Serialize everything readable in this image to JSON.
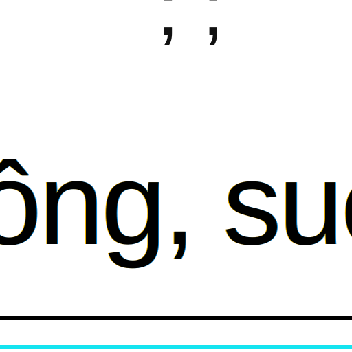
{
  "document": {
    "top_fragment": "; ;",
    "main_text": "ông, suc"
  },
  "colors": {
    "background": "#ffffff",
    "text": "#000000",
    "divider_primary": "#000000",
    "divider_accent": "#15e4f0"
  }
}
